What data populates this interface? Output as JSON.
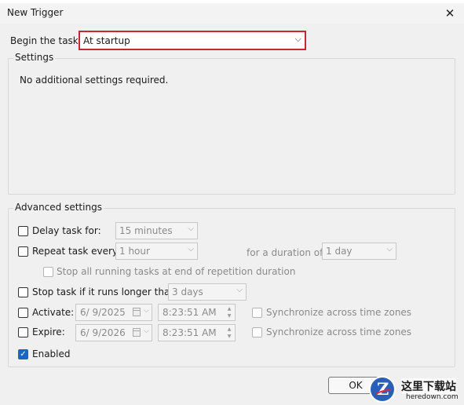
{
  "window": {
    "title": "New Trigger",
    "close_glyph": "✕"
  },
  "begin": {
    "label": "Begin the task:",
    "value": "At startup"
  },
  "settings": {
    "legend": "Settings",
    "message": "No additional settings required."
  },
  "advanced": {
    "legend": "Advanced settings",
    "delay": {
      "label": "Delay task for:",
      "checked": false,
      "value": "15 minutes"
    },
    "repeat": {
      "label": "Repeat task every:",
      "checked": false,
      "value": "1 hour",
      "duration_label": "for a duration of:",
      "duration_value": "1 day"
    },
    "stop_all": {
      "label": "Stop all running tasks at end of repetition duration",
      "checked": false
    },
    "stop_if": {
      "label": "Stop task if it runs longer than:",
      "checked": false,
      "value": "3 days"
    },
    "activate": {
      "label": "Activate:",
      "checked": false,
      "date": "6/ 9/2025",
      "time": "8:23:51 AM",
      "sync_label": "Synchronize across time zones"
    },
    "expire": {
      "label": "Expire:",
      "checked": false,
      "date": "6/ 9/2026",
      "time": "8:23:51 AM",
      "sync_label": "Synchronize across time zones"
    },
    "enabled": {
      "label": "Enabled",
      "checked": true,
      "check_glyph": "✓"
    }
  },
  "buttons": {
    "ok": "OK"
  },
  "watermark": {
    "text": "这里下载站",
    "sub": "heredown.com",
    "logo_letter": "Z"
  }
}
